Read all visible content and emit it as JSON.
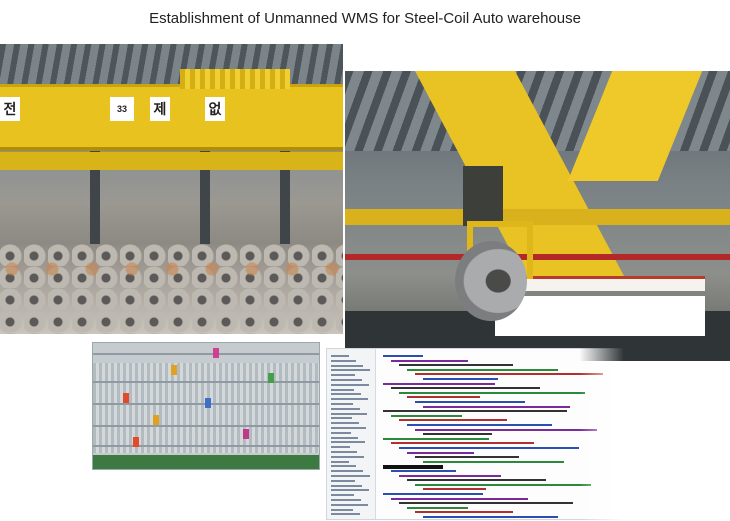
{
  "page": {
    "title": "Establishment of Unmanned WMS for Steel-Coil Auto warehouse"
  },
  "colors": {
    "crane_yellow": "#e8c21e",
    "steel_grey": "#7a8286",
    "status_green": "#3d7a42",
    "accent_red": "#b32828"
  },
  "photos": {
    "warehouse_sign_number": "33",
    "warehouse_sign_chars": [
      "전",
      "제",
      "없"
    ]
  }
}
